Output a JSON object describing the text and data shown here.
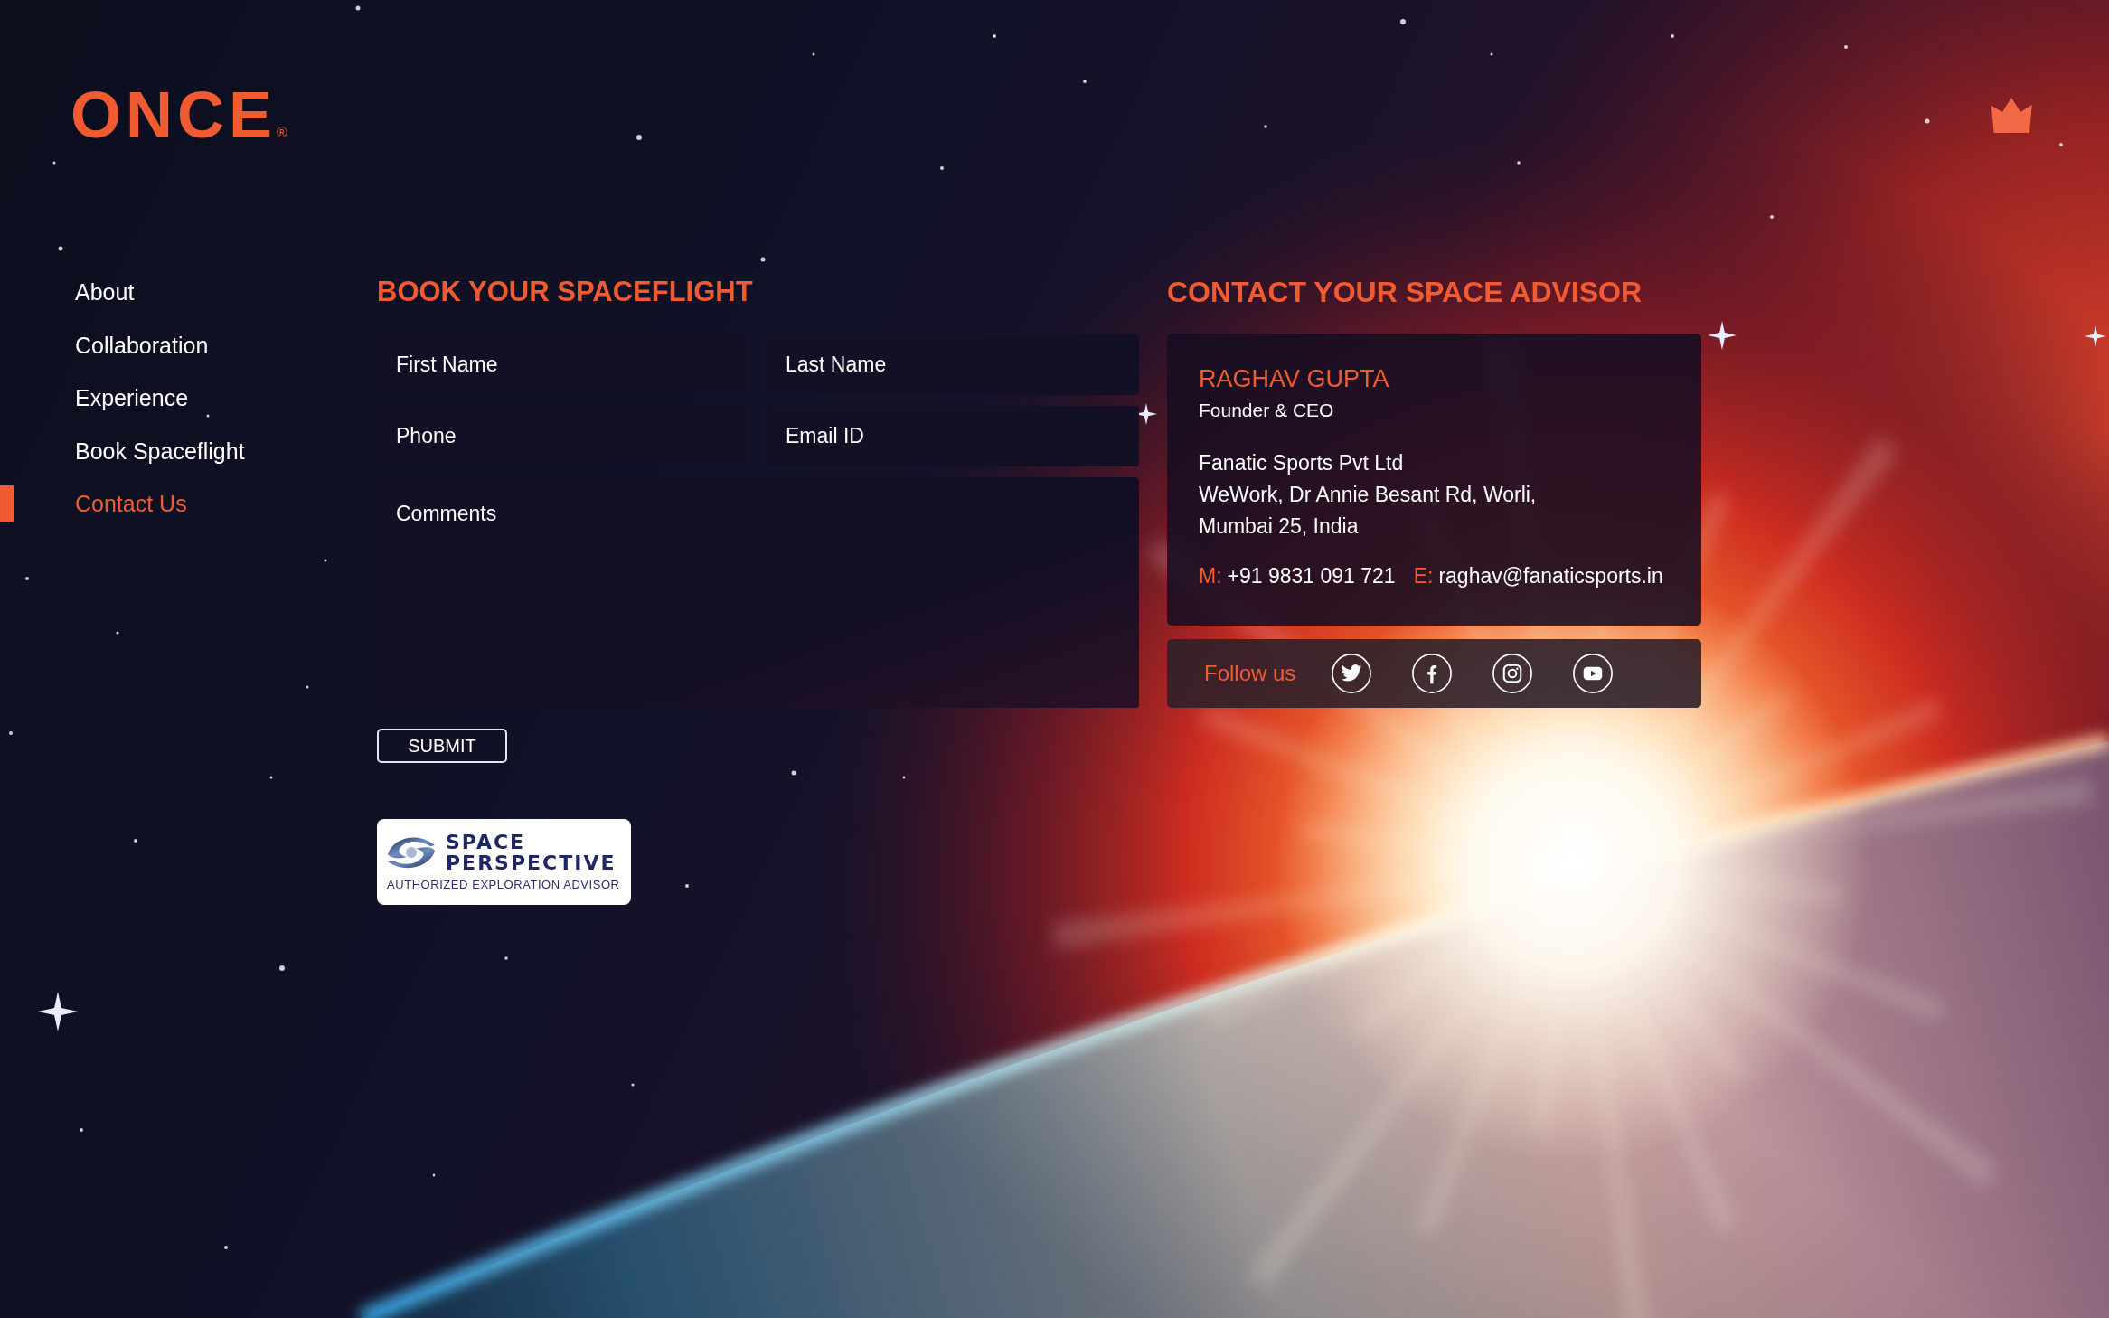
{
  "logo": {
    "text": "ONCE",
    "mark": "®"
  },
  "nav": {
    "items": [
      {
        "label": "About",
        "selected": false
      },
      {
        "label": "Collaboration",
        "selected": false
      },
      {
        "label": "Experience",
        "selected": false
      },
      {
        "label": "Book Spaceflight",
        "selected": false
      },
      {
        "label": "Contact Us",
        "selected": true
      }
    ]
  },
  "booking": {
    "heading": "BOOK YOUR SPACEFLIGHT",
    "fields": [
      {
        "kind": "text",
        "placeholder": "First Name"
      },
      {
        "kind": "text",
        "placeholder": "Last Name"
      },
      {
        "kind": "text",
        "placeholder": "Phone"
      },
      {
        "kind": "text",
        "placeholder": "Email ID"
      },
      {
        "kind": "textarea",
        "placeholder": "Comments"
      }
    ],
    "submit": "SUBMIT",
    "partner_badge": {
      "title": "SPACE PERSPECTIVE",
      "tagline": "AUTHORIZED EXPLORATION ADVISOR"
    }
  },
  "contact": {
    "heading": "CONTACT YOUR SPACE ADVISOR",
    "name": "RAGHAV GUPTA",
    "role": "Founder & CEO",
    "address_lines": [
      "Fanatic Sports Pvt Ltd",
      "WeWork, Dr Annie Besant Rd, Worli,",
      "Mumbai 25, India"
    ],
    "phone": {
      "label": "M:",
      "value": "+91 9831 091 721"
    },
    "email": {
      "label": "E:",
      "value": "raghav@fanaticsports.in"
    },
    "follow": {
      "label": "Follow us",
      "links": [
        {
          "kind": "twitter"
        },
        {
          "kind": "facebook"
        },
        {
          "kind": "instagram"
        },
        {
          "kind": "youtube"
        }
      ]
    }
  }
}
